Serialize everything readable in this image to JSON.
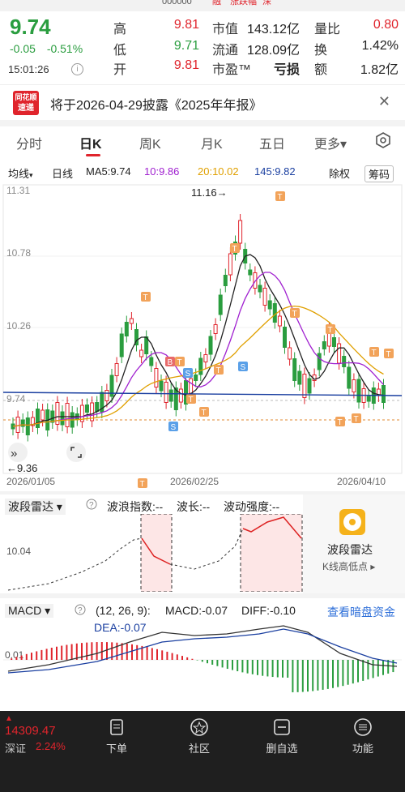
{
  "header": {
    "code_partial": "000000",
    "tag_left": "融",
    "tag_mid": "涨跌幅",
    "tag_right": "深"
  },
  "quote": {
    "price": "9.74",
    "change": "-0.05",
    "change_pct": "-0.51%",
    "time": "15:01:26",
    "high_label": "高",
    "high": "9.81",
    "low_label": "低",
    "low": "9.71",
    "open_label": "开",
    "open": "9.81",
    "mktcap_label": "市值",
    "mktcap": "143.12亿",
    "float_label": "流通",
    "float": "128.09亿",
    "pe_label": "市盈™",
    "pe": "亏损",
    "volratio_label": "量比",
    "volratio": "0.80",
    "turnover_label": "换",
    "turnover": "1.42%",
    "amount_label": "额",
    "amount": "1.82亿"
  },
  "notice": {
    "logo_line1": "同花顺",
    "logo_line2": "速递",
    "text": "将于2026-04-29披露《2025年年报》"
  },
  "tabs": [
    {
      "label": "分时"
    },
    {
      "label": "日K"
    },
    {
      "label": "周K"
    },
    {
      "label": "月K"
    },
    {
      "label": "五日"
    },
    {
      "label": "更多▾"
    }
  ],
  "ma_row": {
    "avg": "均线",
    "avg_arrow": "▾",
    "period": "日线",
    "ma5": "MA5:9.74",
    "ma10": "10:9.86",
    "ma20": "20:10.02",
    "ma145": "145:9.82",
    "adjust": "除权",
    "chips": "筹码"
  },
  "chart_labels": {
    "y_top": "11.31",
    "y_2": "10.78",
    "y_3": "10.26",
    "y_cur": "9.74",
    "max_label": "11.16→",
    "min_label": "←9.36",
    "x1": "2026/01/05",
    "x2": "2026/02/25",
    "x3": "2026/04/10"
  },
  "radar": {
    "title": "波段雷达",
    "wave_index": "波浪指数:--",
    "wave_len": "波长:--",
    "wave_strength": "波动强度:--",
    "y_label": "10.04",
    "side_title": "波段雷达",
    "side_sub": "K线高低点 ▸"
  },
  "macd": {
    "title": "MACD",
    "params": "(12, 26, 9):",
    "macd": "MACD:-0.07",
    "diff": "DIFF:-0.10",
    "dea": "DEA:-0.07",
    "link": "查看暗盘资金",
    "y_label": "0.01"
  },
  "bottom": {
    "index_value": "14309.47",
    "index_name": "深证",
    "index_pct": "2.24%",
    "nav": [
      {
        "label": "下单"
      },
      {
        "label": "社区"
      },
      {
        "label": "删自选"
      },
      {
        "label": "功能"
      }
    ]
  },
  "colors": {
    "up": "#e0242c",
    "down": "#2a9d3f",
    "ma5": "#222222",
    "ma10": "#a020d0",
    "ma20": "#e0a000",
    "ma145": "#1a3fa0"
  }
}
